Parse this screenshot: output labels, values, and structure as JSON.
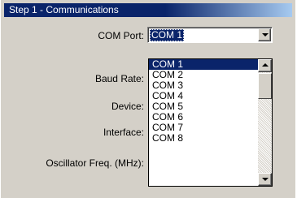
{
  "section": {
    "title": "Step 1 - Communications"
  },
  "fields": {
    "com_port_label": "COM Port:",
    "baud_rate_label": "Baud Rate:",
    "device_label": "Device:",
    "interface_label": "Interface:",
    "oscillator_label": "Oscillator Freq. (MHz):"
  },
  "com_port": {
    "selected": "COM 1",
    "options": [
      "COM 1",
      "COM 2",
      "COM 3",
      "COM 4",
      "COM 5",
      "COM 6",
      "COM 7",
      "COM 8"
    ],
    "highlighted_index": 0
  },
  "colors": {
    "header_bg": "#0a246a",
    "window_bg": "#d4d0c8",
    "selection": "#0a246a"
  },
  "icons": {
    "dropdown": "chevron-down-icon",
    "scroll_up": "scroll-up-icon",
    "scroll_down": "scroll-down-icon"
  }
}
